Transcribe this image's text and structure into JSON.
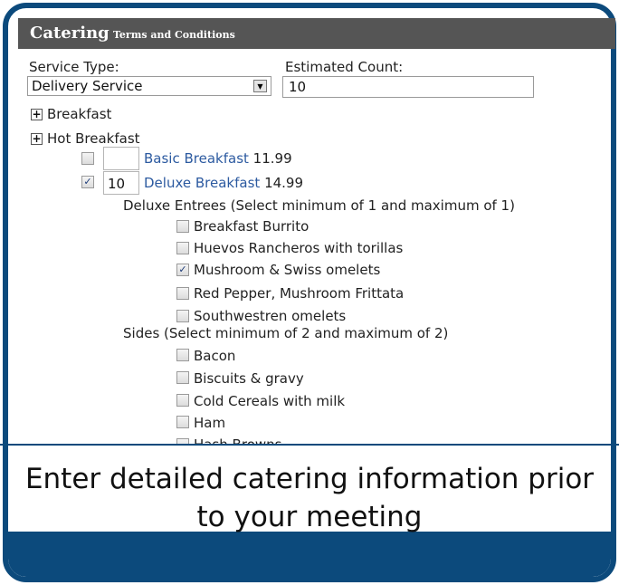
{
  "header": {
    "title": "Catering",
    "subtitle": "Terms and Conditions"
  },
  "form": {
    "service_type_label": "Service Type:",
    "service_type_value": "Delivery Service",
    "estimated_count_label": "Estimated Count:",
    "estimated_count_value": "10"
  },
  "sections": {
    "breakfast": "Breakfast",
    "hot_breakfast": "Hot Breakfast"
  },
  "items": {
    "basic": {
      "name": "Basic Breakfast",
      "price": "11.99",
      "qty": "",
      "checked": false
    },
    "deluxe": {
      "name": "Deluxe Breakfast",
      "price": "14.99",
      "qty": "10",
      "checked": true
    }
  },
  "entrees": {
    "heading": "Deluxe Entrees (Select minimum of 1 and maximum of 1)",
    "options": [
      {
        "label": "Breakfast Burrito",
        "checked": false
      },
      {
        "label": "Huevos Rancheros with torillas",
        "checked": false
      },
      {
        "label": "Mushroom & Swiss omelets",
        "checked": true
      },
      {
        "label": "Red Pepper, Mushroom Frittata",
        "checked": false
      },
      {
        "label": "Southwestren omelets",
        "checked": false
      }
    ]
  },
  "sides": {
    "heading": "Sides (Select minimum of 2 and maximum of 2)",
    "options": [
      {
        "label": "Bacon",
        "checked": false
      },
      {
        "label": "Biscuits & gravy",
        "checked": false
      },
      {
        "label": "Cold Cereals with milk",
        "checked": false
      },
      {
        "label": "Ham",
        "checked": false
      },
      {
        "label": "Hash Browns",
        "checked": false
      }
    ]
  },
  "caption": {
    "line1": "Enter detailed catering information prior",
    "line2": "to your meeting"
  },
  "icons": {
    "expand": "+",
    "check": "✓",
    "dropdown": "▼"
  },
  "colors": {
    "frame": "#0c4a7c",
    "header": "#555555",
    "link": "#2c5aa0"
  }
}
